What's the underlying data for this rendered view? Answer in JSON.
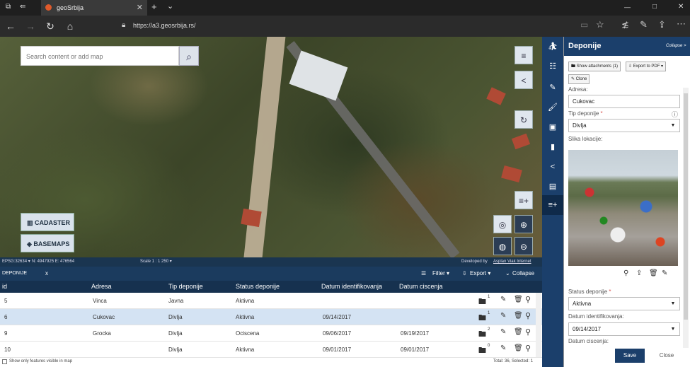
{
  "browser": {
    "tab_title": "geoSrbija",
    "url": "https://a3.geosrbija.rs/",
    "tab_close": "✕",
    "new_tab": "+",
    "tab_menu": "⌄",
    "window": {
      "minimize": "—",
      "maximize": "□",
      "close": "✕"
    }
  },
  "map": {
    "search_placeholder": "Search content or add map",
    "cadaster_label": "CADASTER",
    "basemaps_label": "BASEMAPS",
    "status": {
      "epsg": "EPSG:32634 ▾",
      "coords": "N: 4947925 E: 476564",
      "scale": "Scale 1 : 1 250 ▾",
      "credit_prefix": "Developed by",
      "credit_link": "Asplan Viak Internet"
    }
  },
  "grid": {
    "tab_label": "DEPONIJE",
    "tab_close": "x",
    "filter_label": "Filter ▾",
    "export_label": "Export ▾",
    "collapse_label": "Collapse",
    "columns": [
      "id",
      "Adresa",
      "Tip deponije",
      "Status deponije",
      "Datum identifikovanja",
      "Datum ciscenja"
    ],
    "rows": [
      {
        "id": "5",
        "adresa": "Vinca",
        "tip": "Javna",
        "status": "Aktivna",
        "datum_id": "",
        "datum_c": "",
        "att": "1"
      },
      {
        "id": "6",
        "adresa": "Cukovac",
        "tip": "Divlja",
        "status": "Aktivna",
        "datum_id": "09/14/2017",
        "datum_c": "",
        "att": "1"
      },
      {
        "id": "9",
        "adresa": "Grocka",
        "tip": "Divlja",
        "status": "Ociscena",
        "datum_id": "09/06/2017",
        "datum_c": "09/19/2017",
        "att": "2"
      },
      {
        "id": "10",
        "adresa": "",
        "tip": "Divlja",
        "status": "Aktivna",
        "datum_id": "09/01/2017",
        "datum_c": "09/01/2017",
        "att": "0"
      }
    ],
    "show_only_visible": "Show only features visible in map",
    "total": "Total: 36, Selected: 1"
  },
  "panel": {
    "title": "Deponije",
    "collapse": "Collapse >",
    "show_attachments": "Show attachments (1)",
    "export_pdf": "Export to PDF ▾",
    "clone": "Clone",
    "adresa_label": "Adresa:",
    "adresa_value": "Cukovac",
    "tip_label": "Tip deponije",
    "required_mark": "*",
    "tip_value": "Divlja",
    "slika_label": "Slika lokacije:",
    "status_label": "Status deponije",
    "status_value": "Aktivna",
    "datum_id_label": "Datum identifikovanja:",
    "datum_id_value": "09/14/2017",
    "datum_c_label": "Datum ciscenja:",
    "save": "Save",
    "close": "Close"
  },
  "colors": {
    "navy": "#1b3f6b",
    "selected_row": "#d4e3f3",
    "required": "#d9534f"
  }
}
